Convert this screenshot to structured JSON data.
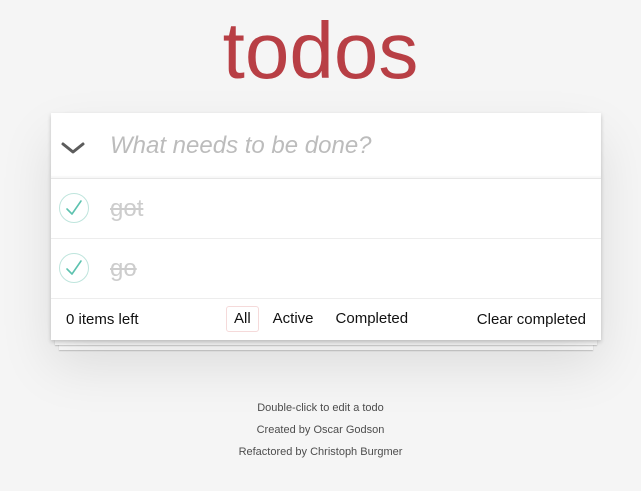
{
  "header": {
    "title": "todos"
  },
  "new_todo": {
    "placeholder": "What needs to be done?"
  },
  "todos": [
    {
      "label": "got",
      "completed": true
    },
    {
      "label": "go",
      "completed": true
    }
  ],
  "footer": {
    "count": "0 items left",
    "filters": [
      "All",
      "Active",
      "Completed"
    ],
    "selected_filter": "All",
    "clear": "Clear completed"
  },
  "info": {
    "line1": "Double-click to edit a todo",
    "line2": "Created by Oscar Godson",
    "line3": "Refactored by Christoph Burgmer"
  },
  "colors": {
    "title": "#b83f45",
    "check": "#5dc2af",
    "background": "#f5f5f5"
  },
  "icons": {
    "toggle_all": "chevron-down-icon",
    "todo_check": "checkmark-icon"
  }
}
